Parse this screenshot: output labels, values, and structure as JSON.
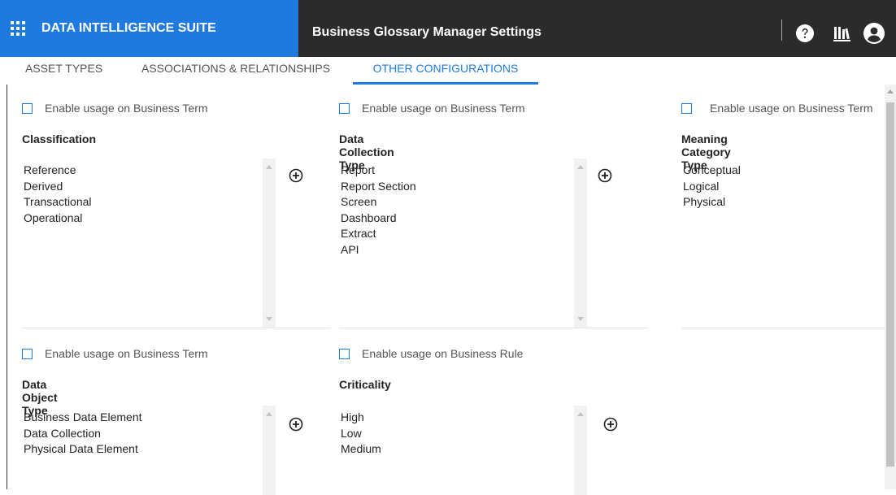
{
  "app": {
    "brand": "DATA INTELLIGENCE SUITE",
    "page_title": "Business Glossary Manager Settings",
    "icons": [
      "apps-grid-icon",
      "help-icon",
      "library-icon",
      "user-account-icon"
    ]
  },
  "tabs": [
    {
      "label": "ASSET TYPES",
      "active": false
    },
    {
      "label": "ASSOCIATIONS & RELATIONSHIPS",
      "active": false
    },
    {
      "label": "OTHER CONFIGURATIONS",
      "active": true
    }
  ],
  "panels": [
    {
      "checkbox_label": "Enable usage on Business Term",
      "checked": false,
      "title": "Classification",
      "items": [
        "Reference",
        "Derived",
        "Transactional",
        "Operational"
      ]
    },
    {
      "checkbox_label": "Enable usage on Business Term",
      "checked": false,
      "title": "Data Collection Type",
      "items": [
        "Report",
        "Report Section",
        "Screen",
        "Dashboard",
        "Extract",
        "API"
      ]
    },
    {
      "checkbox_label": "Enable usage on Business Term",
      "checked": false,
      "title": "Meaning Category Type",
      "items": [
        "Conceptual",
        "Logical",
        "Physical"
      ]
    },
    {
      "checkbox_label": "Enable usage on Business Term",
      "checked": false,
      "title": "Data Object Type",
      "items": [
        "Business Data Element",
        "Data Collection",
        "Physical Data Element"
      ]
    },
    {
      "checkbox_label": "Enable usage on Business Rule",
      "checked": false,
      "title": "Criticality",
      "items": [
        "High",
        "Low",
        "Medium"
      ]
    }
  ],
  "colors": {
    "brand_blue": "#1f7ae0",
    "topbar": "#2b2b2b"
  }
}
